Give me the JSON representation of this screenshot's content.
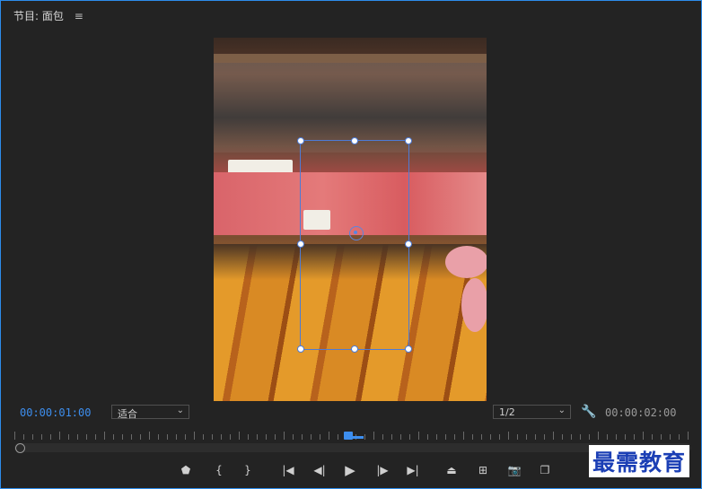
{
  "panel": {
    "title": "节目: 面包",
    "menu_icon": "hamburger-icon",
    "accent_color": "#3d8eee"
  },
  "timecode": {
    "current": "00:00:01:00",
    "duration": "00:00:02:00"
  },
  "zoom_select": {
    "value": "适合"
  },
  "resolution_select": {
    "value": "1/2"
  },
  "settings_icon": "wrench-icon",
  "controls": [
    {
      "name": "add-marker-button",
      "icon": "marker-icon",
      "glyph": "⬟"
    },
    {
      "name": "mark-in-button",
      "icon": "mark-in-icon",
      "glyph": "{"
    },
    {
      "name": "mark-out-button",
      "icon": "mark-out-icon",
      "glyph": "}"
    },
    {
      "name": "go-to-in-button",
      "icon": "go-to-in-icon",
      "glyph": "|◀"
    },
    {
      "name": "step-back-button",
      "icon": "step-back-icon",
      "glyph": "◀|"
    },
    {
      "name": "play-button",
      "icon": "play-icon",
      "glyph": "▶"
    },
    {
      "name": "step-forward-button",
      "icon": "step-forward-icon",
      "glyph": "|▶"
    },
    {
      "name": "go-to-out-button",
      "icon": "go-to-out-icon",
      "glyph": "▶|"
    },
    {
      "name": "lift-button",
      "icon": "lift-icon",
      "glyph": "⏏"
    },
    {
      "name": "extract-button",
      "icon": "extract-icon",
      "glyph": "⊞"
    },
    {
      "name": "export-frame-button",
      "icon": "camera-icon",
      "glyph": "📷"
    },
    {
      "name": "comparison-view-button",
      "icon": "comparison-icon",
      "glyph": "❐"
    }
  ],
  "watermark": "最需教育"
}
